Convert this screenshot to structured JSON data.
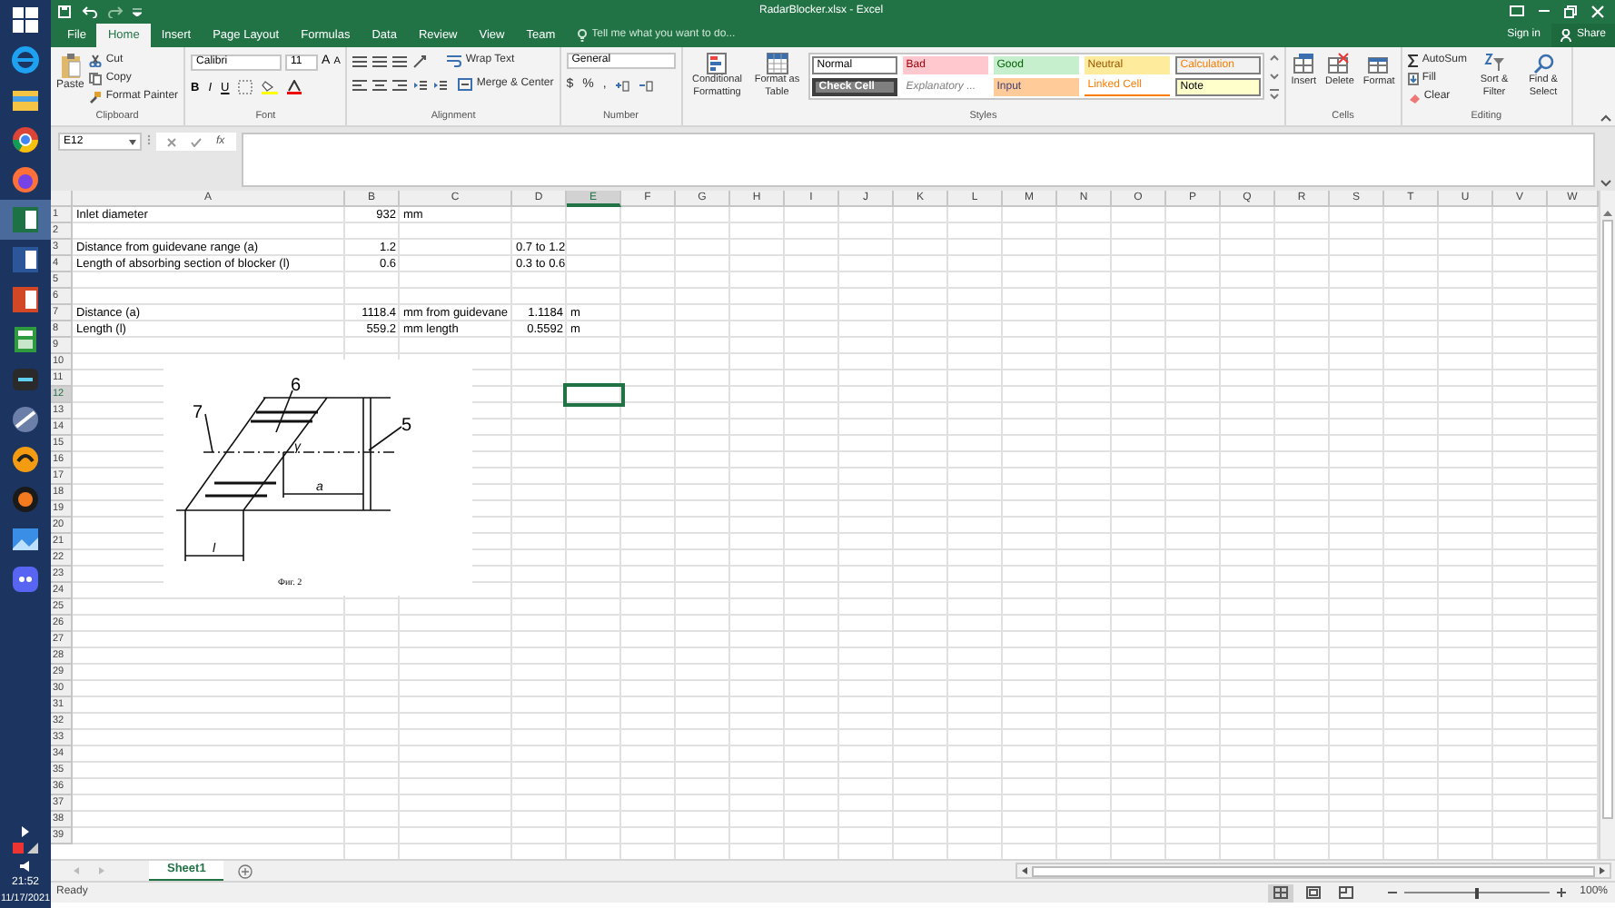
{
  "taskbar": {
    "apps": [
      {
        "kind": "start",
        "selected": false
      },
      {
        "kind": "ie",
        "selected": false
      },
      {
        "kind": "folder",
        "selected": false
      },
      {
        "kind": "chrome",
        "selected": false
      },
      {
        "kind": "firefox",
        "selected": false
      },
      {
        "kind": "excel",
        "selected": true
      },
      {
        "kind": "word",
        "selected": false
      },
      {
        "kind": "powerpoint",
        "selected": false
      },
      {
        "kind": "calculator",
        "selected": false
      },
      {
        "kind": "nox",
        "selected": false
      },
      {
        "kind": "paint",
        "selected": false
      },
      {
        "kind": "orange",
        "selected": false
      },
      {
        "kind": "media",
        "selected": false
      },
      {
        "kind": "photos",
        "selected": false
      },
      {
        "kind": "discord",
        "selected": false
      }
    ],
    "time": "21:52",
    "date": "11/17/2021"
  },
  "window": {
    "title": "RadarBlocker.xlsx - Excel"
  },
  "tabs": [
    {
      "label": "File",
      "selected": false
    },
    {
      "label": "Home",
      "selected": true
    },
    {
      "label": "Insert",
      "selected": false
    },
    {
      "label": "Page Layout",
      "selected": false
    },
    {
      "label": "Formulas",
      "selected": false
    },
    {
      "label": "Data",
      "selected": false
    },
    {
      "label": "Review",
      "selected": false
    },
    {
      "label": "View",
      "selected": false
    },
    {
      "label": "Team",
      "selected": false
    }
  ],
  "tell_me": {
    "placeholder": "Tell me what you want to do..."
  },
  "account": {
    "sign_in": "Sign in",
    "share": "Share"
  },
  "clipboard": {
    "paste": "Paste",
    "cut": "Cut",
    "copy": "Copy",
    "format_painter": "Format Painter",
    "label": "Clipboard"
  },
  "font": {
    "name": "Calibri",
    "size": "11",
    "bold": "B",
    "italic": "I",
    "underline": "U",
    "grow": "A",
    "shrink": "A",
    "label": "Font"
  },
  "alignment": {
    "wrap_text": "Wrap Text",
    "merge": "Merge & Center",
    "label": "Alignment"
  },
  "number": {
    "format": "General",
    "currency": "$",
    "percent": "%",
    "comma": ",",
    "label": "Number"
  },
  "styles": {
    "conditional": "Conditional Formatting",
    "format_table": "Format as Table",
    "label": "Styles",
    "gallery": [
      {
        "label": "Normal",
        "color": "#ffffff"
      },
      {
        "label": "Bad",
        "color": "#ffc7ce"
      },
      {
        "label": "Good",
        "color": "#c6efce"
      },
      {
        "label": "Neutral",
        "color": "#ffeb9c"
      },
      {
        "label": "Calculation",
        "color": "#f2f2f2"
      },
      {
        "label": "Check Cell",
        "color": "#7f7f7f"
      },
      {
        "label": "Explanatory ...",
        "color": "#ffffff"
      },
      {
        "label": "Input",
        "color": "#ffcc99"
      },
      {
        "label": "Linked Cell",
        "color": "#ffffff"
      },
      {
        "label": "Note",
        "color": "#ffffcc"
      }
    ]
  },
  "cells": {
    "insert": "Insert",
    "delete": "Delete",
    "format": "Format",
    "label": "Cells"
  },
  "editing": {
    "autosum": "AutoSum",
    "fill": "Fill",
    "clear": "Clear",
    "sort": "Sort & Filter",
    "find": "Find & Select",
    "label": "Editing"
  },
  "formula_bar": {
    "name_box": "E12",
    "fx": "fx"
  },
  "columns": [
    {
      "label": "A",
      "selected": false
    },
    {
      "label": "B",
      "selected": false
    },
    {
      "label": "C",
      "selected": false
    },
    {
      "label": "D",
      "selected": false
    },
    {
      "label": "E",
      "selected": true
    },
    {
      "label": "F",
      "selected": false
    },
    {
      "label": "G",
      "selected": false
    },
    {
      "label": "H",
      "selected": false
    },
    {
      "label": "I",
      "selected": false
    },
    {
      "label": "J",
      "selected": false
    },
    {
      "label": "K",
      "selected": false
    },
    {
      "label": "L",
      "selected": false
    },
    {
      "label": "M",
      "selected": false
    },
    {
      "label": "N",
      "selected": false
    },
    {
      "label": "O",
      "selected": false
    },
    {
      "label": "P",
      "selected": false
    },
    {
      "label": "Q",
      "selected": false
    },
    {
      "label": "R",
      "selected": false
    },
    {
      "label": "S",
      "selected": false
    },
    {
      "label": "T",
      "selected": false
    },
    {
      "label": "U",
      "selected": false
    },
    {
      "label": "V",
      "selected": false
    },
    {
      "label": "W",
      "selected": false
    }
  ],
  "rows": [
    {
      "label": "1",
      "selected": false,
      "a": {
        "value": "Inlet diameter",
        "kind": "text"
      },
      "b": {
        "value": "932",
        "kind": "number"
      },
      "c": {
        "value": "mm",
        "kind": "text"
      }
    },
    {
      "label": "2",
      "selected": false
    },
    {
      "label": "3",
      "selected": false,
      "a": {
        "value": "Distance from guidevane range  (a)",
        "kind": "text"
      },
      "b": {
        "value": "1.2",
        "kind": "number"
      },
      "d": {
        "value": "0.7 to 1.2",
        "kind": "text"
      }
    },
    {
      "label": "4",
      "selected": false,
      "a": {
        "value": "Length of absorbing section of blocker (l)",
        "kind": "text"
      },
      "b": {
        "value": "0.6",
        "kind": "number"
      },
      "d": {
        "value": "0.3 to 0.6",
        "kind": "text"
      }
    },
    {
      "label": "5",
      "selected": false
    },
    {
      "label": "6",
      "selected": false
    },
    {
      "label": "7",
      "selected": false,
      "a": {
        "value": "Distance (a)",
        "kind": "text"
      },
      "b": {
        "value": "1118.4",
        "kind": "number"
      },
      "c": {
        "value": "mm from guidevane",
        "kind": "text"
      },
      "d": {
        "value": "1.1184",
        "kind": "number"
      },
      "e": {
        "value": "m",
        "kind": "text"
      }
    },
    {
      "label": "8",
      "selected": false,
      "a": {
        "value": "Length (l)",
        "kind": "text"
      },
      "b": {
        "value": "559.2",
        "kind": "number"
      },
      "c": {
        "value": "mm length",
        "kind": "text"
      },
      "d": {
        "value": "0.5592",
        "kind": "number"
      },
      "e": {
        "value": "m",
        "kind": "text"
      }
    },
    {
      "label": "9",
      "selected": false
    },
    {
      "label": "10",
      "selected": false
    },
    {
      "label": "11",
      "selected": false
    },
    {
      "label": "12",
      "selected": true
    },
    {
      "label": "13",
      "selected": false
    },
    {
      "label": "14",
      "selected": false
    },
    {
      "label": "15",
      "selected": false
    },
    {
      "label": "16",
      "selected": false
    },
    {
      "label": "17",
      "selected": false
    },
    {
      "label": "18",
      "selected": false
    },
    {
      "label": "19",
      "selected": false
    },
    {
      "label": "20",
      "selected": false
    },
    {
      "label": "21",
      "selected": false
    },
    {
      "label": "22",
      "selected": false
    },
    {
      "label": "23",
      "selected": false
    },
    {
      "label": "24",
      "selected": false
    },
    {
      "label": "25",
      "selected": false
    },
    {
      "label": "26",
      "selected": false
    },
    {
      "label": "27",
      "selected": false
    },
    {
      "label": "28",
      "selected": false
    },
    {
      "label": "29",
      "selected": false
    },
    {
      "label": "30",
      "selected": false
    },
    {
      "label": "31",
      "selected": false
    },
    {
      "label": "32",
      "selected": false
    },
    {
      "label": "33",
      "selected": false
    },
    {
      "label": "34",
      "selected": false
    },
    {
      "label": "35",
      "selected": false
    },
    {
      "label": "36",
      "selected": false
    },
    {
      "label": "37",
      "selected": false
    },
    {
      "label": "38",
      "selected": false
    },
    {
      "label": "39",
      "selected": false
    }
  ],
  "figure": {
    "label_6": "6",
    "label_7": "7",
    "label_5": "5",
    "angle": "γ",
    "dim_a": "a",
    "dim_l": "l",
    "caption": "Фиг. 2"
  },
  "sheet_tabs": [
    {
      "label": "Sheet1",
      "selected": true
    }
  ],
  "status_bar": {
    "status": "Ready",
    "zoom": "100%",
    "zoom_slider": {
      "level": 0.5
    },
    "views": [
      {
        "kind": "normal",
        "selected": true
      },
      {
        "kind": "page_layout",
        "selected": false
      },
      {
        "kind": "page_break",
        "selected": false
      }
    ]
  }
}
